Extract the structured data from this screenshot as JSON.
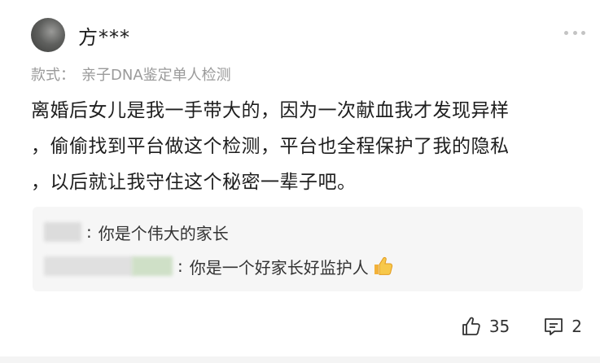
{
  "user": {
    "name": "方***"
  },
  "variant": {
    "label": "款式：",
    "value": "亲子DNA鉴定单人检测"
  },
  "comment": {
    "text": "离婚后女儿是我一手带大的，因为一次献血我才发现异样\n，偷偷找到平台做这个检测，平台也全程保护了我的隐私\n，以后就让我守住这个秘密一辈子吧。"
  },
  "replies": [
    {
      "text": "你是个伟大的家长"
    },
    {
      "text": "你是一个好家长好监护人",
      "emoji": "thumbs-up-emoji"
    }
  ],
  "actions": {
    "like_count": "35",
    "comment_count": "2"
  },
  "icons": [
    "more-icon",
    "like-icon",
    "comment-icon",
    "thumbs-up-emoji"
  ],
  "colors": {
    "background": "#ffffff",
    "reply_bg": "#f6f6f6",
    "muted_text": "#9a9a9a",
    "text": "#1e1e1e"
  }
}
